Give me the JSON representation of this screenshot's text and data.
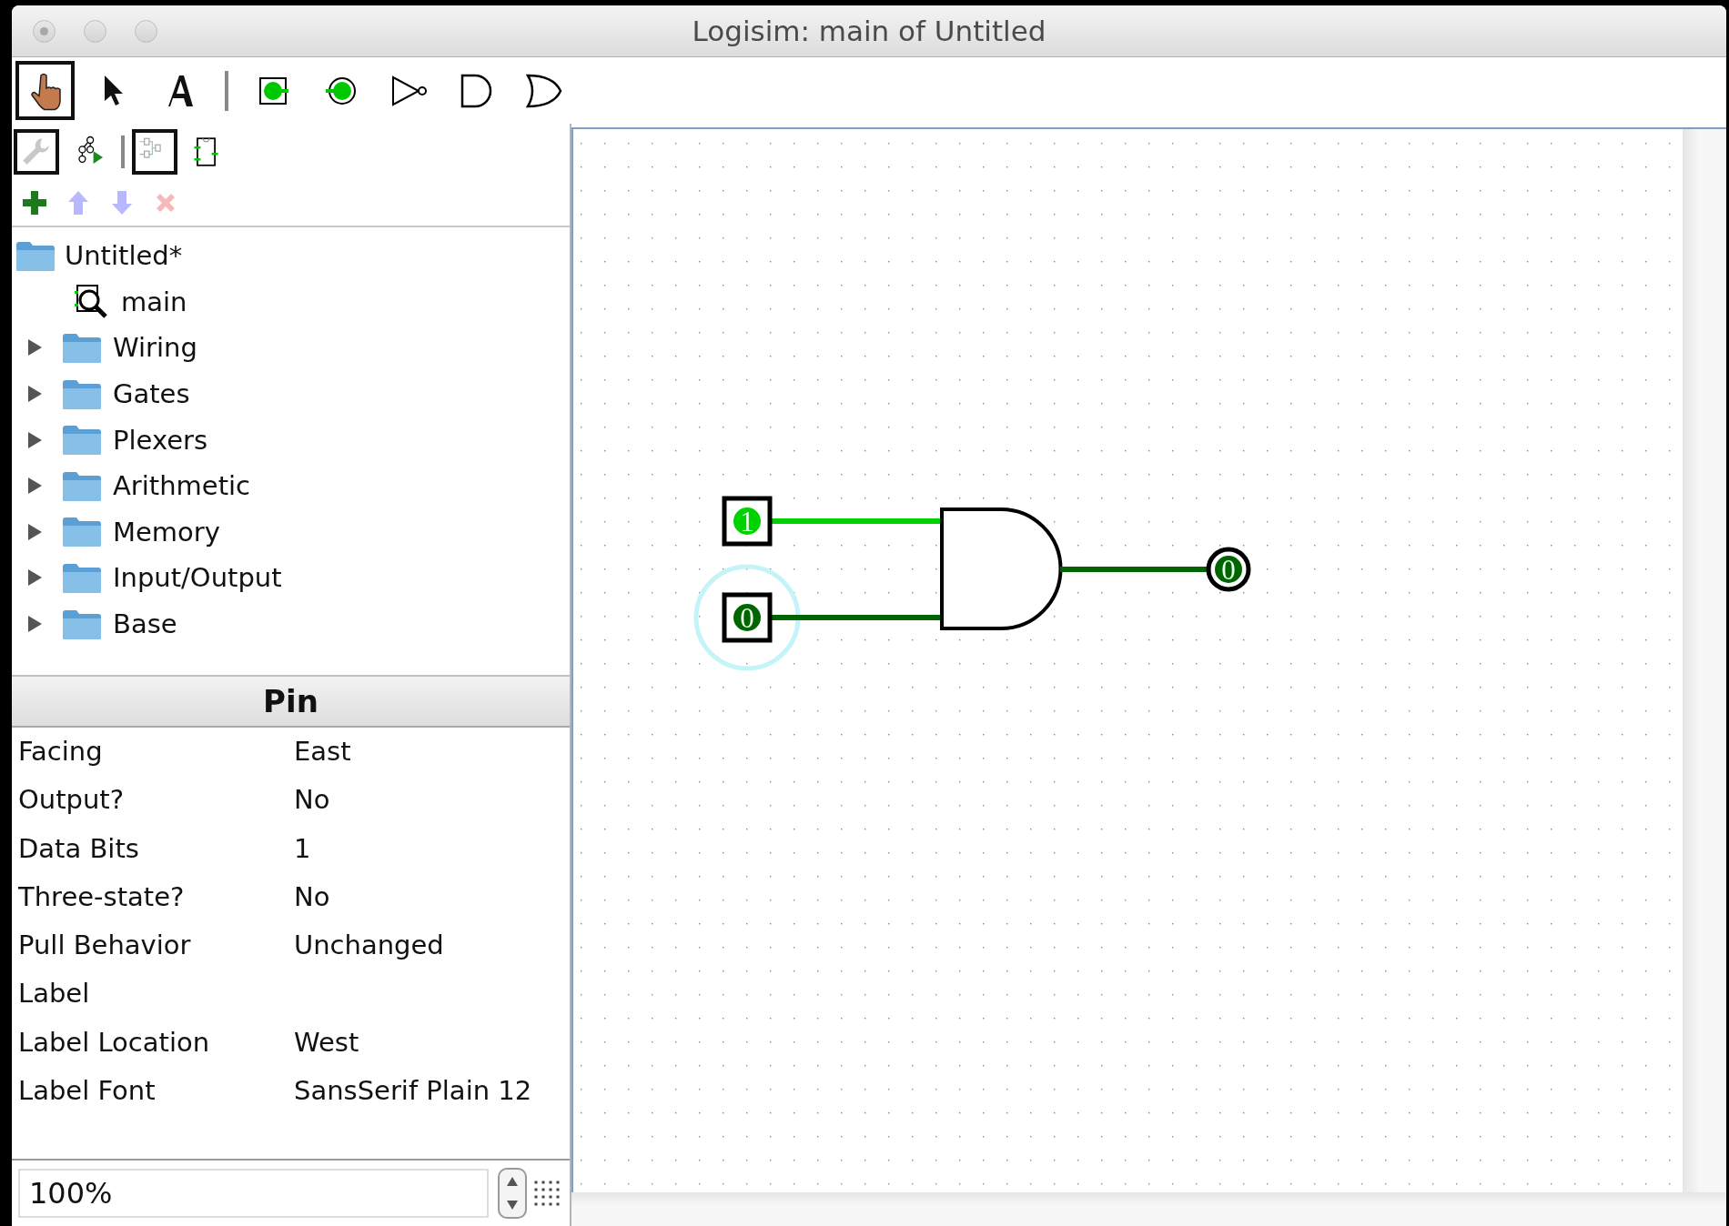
{
  "window": {
    "title": "Logisim: main of Untitled"
  },
  "toolbar": {
    "tool_groups": [
      [
        {
          "kind": "hand",
          "selected": true
        },
        {
          "kind": "pointer",
          "selected": false
        },
        {
          "kind": "text",
          "selected": false
        }
      ],
      [
        {
          "kind": "input-pin",
          "selected": false
        },
        {
          "kind": "output-pin",
          "selected": false
        },
        {
          "kind": "not-gate",
          "selected": false
        },
        {
          "kind": "and-gate",
          "selected": false
        },
        {
          "kind": "or-gate",
          "selected": false
        }
      ]
    ]
  },
  "explorer_toolbar": {
    "view_groups": [
      [
        {
          "kind": "toolbox",
          "selected": true
        },
        {
          "kind": "simulation",
          "selected": false
        }
      ],
      [
        {
          "kind": "layout",
          "selected": true
        },
        {
          "kind": "appearance",
          "selected": false
        }
      ]
    ]
  },
  "circuit_actions": [
    {
      "kind": "add",
      "disabled": false
    },
    {
      "kind": "up",
      "disabled": true
    },
    {
      "kind": "down",
      "disabled": true
    },
    {
      "kind": "delete",
      "disabled": true
    }
  ],
  "tree": {
    "name": "Untitled*",
    "children": [
      {
        "kind": "circuit",
        "name": "main"
      },
      {
        "kind": "library",
        "name": "Wiring",
        "expanded": false
      },
      {
        "kind": "library",
        "name": "Gates",
        "expanded": false
      },
      {
        "kind": "library",
        "name": "Plexers",
        "expanded": false
      },
      {
        "kind": "library",
        "name": "Arithmetic",
        "expanded": false
      },
      {
        "kind": "library",
        "name": "Memory",
        "expanded": false
      },
      {
        "kind": "library",
        "name": "Input/Output",
        "expanded": false
      },
      {
        "kind": "library",
        "name": "Base",
        "expanded": false
      }
    ]
  },
  "attributes": {
    "title": "Pin",
    "rows": [
      {
        "name": "Facing",
        "value": "East"
      },
      {
        "name": "Output?",
        "value": "No"
      },
      {
        "name": "Data Bits",
        "value": "1"
      },
      {
        "name": "Three-state?",
        "value": "No"
      },
      {
        "name": "Pull Behavior",
        "value": "Unchanged"
      },
      {
        "name": "Label"
      },
      {
        "name": "Label Location",
        "value": "West"
      },
      {
        "name": "Label Font",
        "value": "SansSerif Plain 12"
      }
    ]
  },
  "zoom": {
    "value": "100%"
  },
  "canvas": {
    "inputs": [
      {
        "value": "1",
        "on": true,
        "selected": false
      },
      {
        "value": "0",
        "on": false,
        "selected": true
      }
    ],
    "gate": {
      "kind": "and"
    },
    "output": {
      "value": "0",
      "on": false
    }
  }
}
